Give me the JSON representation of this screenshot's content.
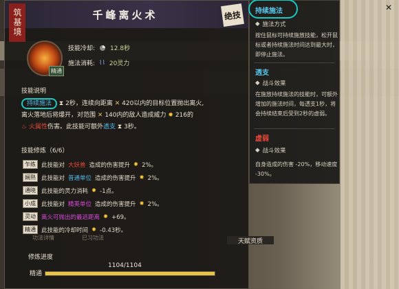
{
  "skill": {
    "category_tag": "筑基境",
    "name": "千峰离火术",
    "seal_text": "绝技",
    "icon_badge": "精通",
    "cooldown_label": "技能冷却:",
    "cooldown_value": "12.8秒",
    "cost_label": "施法消耗:",
    "cost_value": "20灵力"
  },
  "description": {
    "heading": "技能说明",
    "keyword_channel": "持续施法",
    "channel_time": "2秒",
    "text_1": "，连续向距离",
    "range_value": "420",
    "text_2": "以内的目标位置抛出离火,",
    "text_3": "离火落地后将爆开，对范围",
    "aoe_value": "140",
    "text_4": "内的敌人造成威力",
    "power_value": "216",
    "text_5": "的",
    "element": "火属性",
    "text_6": "伤害。此技能可额外",
    "keyword_extend": "透支",
    "extend_time": "3秒",
    "text_7": "。"
  },
  "mods": {
    "heading": "技能修炼（6/6）",
    "rows": [
      {
        "tag": "乍练",
        "pre": "此技能对",
        "target": "大妖兽",
        "target_color": "red",
        "post": "造成的伤害提升",
        "value": "2%。"
      },
      {
        "tag": "娴熟",
        "pre": "此技能对",
        "target": "普通单位",
        "target_color": "blue",
        "post": "造成的伤害提升",
        "value": "2%。"
      },
      {
        "tag": "通晓",
        "pre": "此技能的灵力消耗",
        "target": "",
        "target_color": "",
        "post": "",
        "value": "-1点。"
      },
      {
        "tag": "小成",
        "pre": "此技能对",
        "target": "精英单位",
        "target_color": "mag",
        "post": "造成的伤害提升",
        "value": "2%。"
      },
      {
        "tag": "灵动",
        "pre": "",
        "target": "离火可抛出的最远距离",
        "target_color": "mag",
        "post": "",
        "value": "+69。"
      },
      {
        "tag": "精通",
        "pre": "此技能的冷却时间",
        "target": "",
        "target_color": "",
        "post": "",
        "value": "-0.43秒。"
      }
    ]
  },
  "progress": {
    "label": "修炼进度",
    "value_text": "1104/1104",
    "fraction": 1.0,
    "rank_tag": "精通"
  },
  "bottom_tabs": [
    "功法详情",
    "已习功法"
  ],
  "attr_box": "天赋资质",
  "right_panel": {
    "sections": [
      {
        "title": "持续施法",
        "sub": "施法方式",
        "text": "按住鼠标可持续施放技能，松开鼠标或者持续施法时间达到最大时，即停止施法。"
      },
      {
        "title": "透支",
        "sub": "战斗效果",
        "text": "在施放持续施法的技能时，可额外增加的施法时间，每透支1秒，将会持续结束后受到2秒的虚弱。"
      },
      {
        "title": "虚弱",
        "sub": "战斗效果",
        "text": "自身造成的伤害 -20%，移动速度 -30%。"
      }
    ],
    "weak_link": "虚弱"
  },
  "colors": {
    "accent_cyan": "#18c9c4",
    "keyword_blue": "#4fb9e8",
    "fire_red": "#e44a3a",
    "gold": "#f2c33a",
    "tag_red": "#8a1f1c"
  }
}
